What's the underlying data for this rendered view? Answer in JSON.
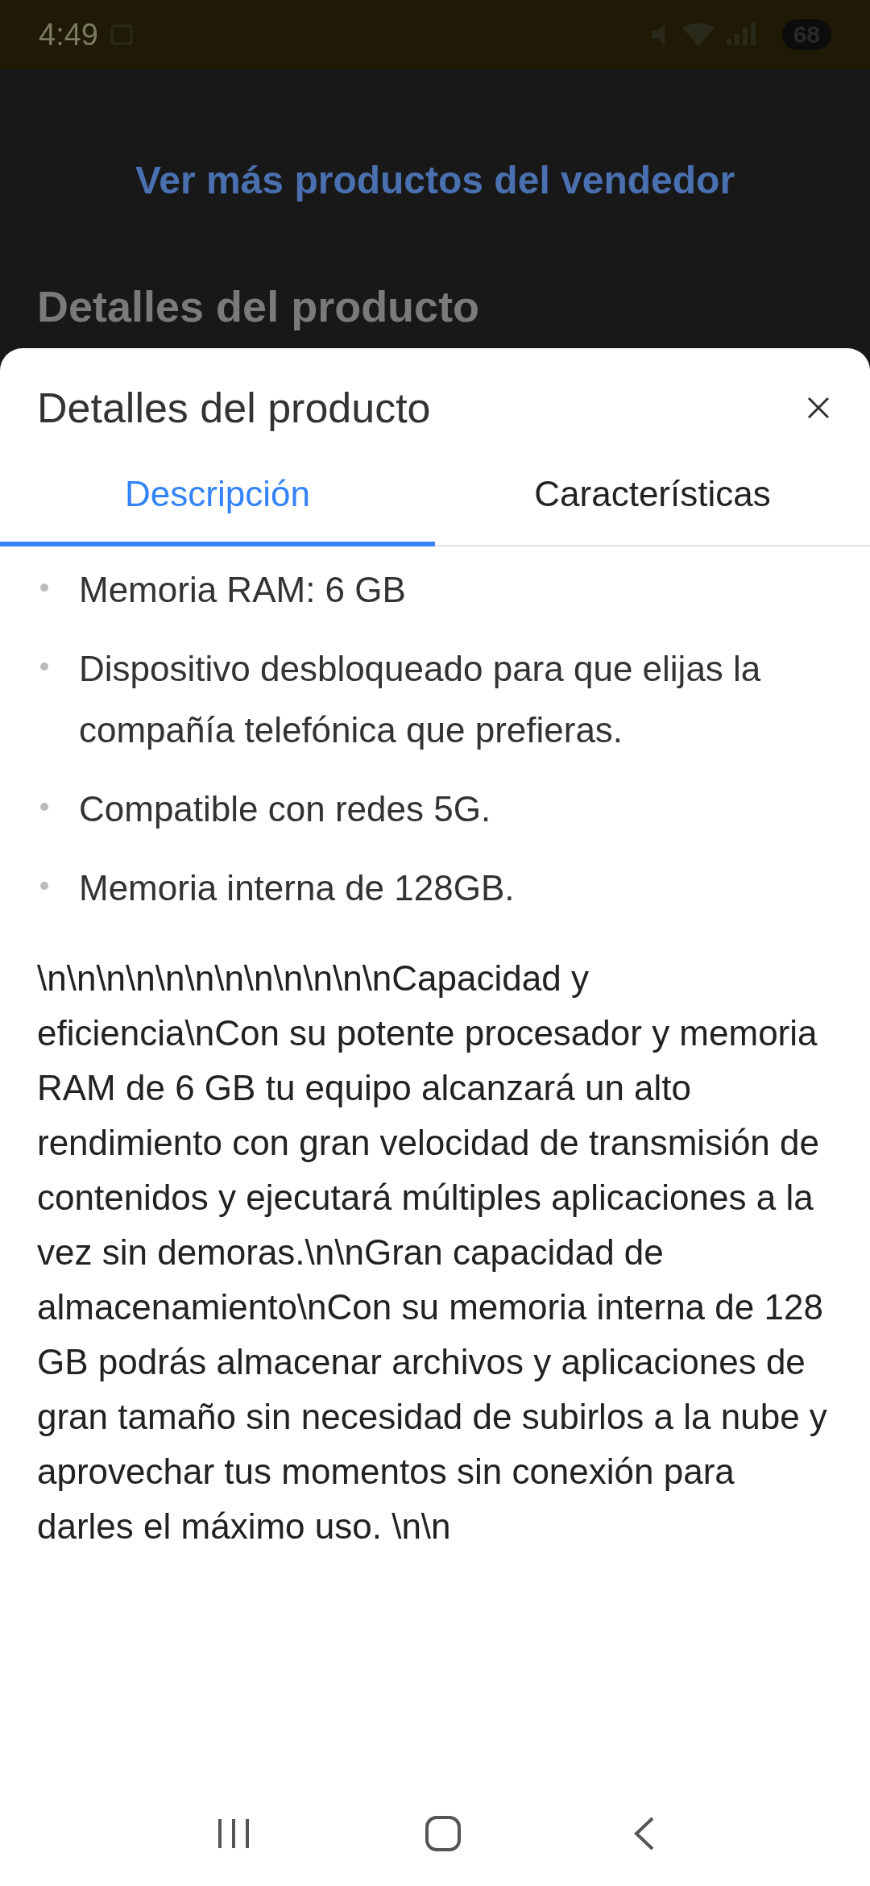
{
  "status_bar": {
    "time": "4:49",
    "battery": "68"
  },
  "background": {
    "link": "Ver más productos del vendedor",
    "heading": "Detalles del producto"
  },
  "sheet": {
    "title": "Detalles del producto",
    "tabs": [
      {
        "label": "Descripción",
        "selected": true
      },
      {
        "label": "Características",
        "selected": false
      }
    ],
    "bullets": [
      "Memoria RAM: 6 GB",
      "Dispositivo desbloqueado para que elijas la compañía telefónica que prefieras.",
      "Compatible con redes 5G.",
      "Memoria interna de 128GB."
    ],
    "paragraph": "\\n\\n\\n\\n\\n\\n\\n\\n\\n\\n\\n\\nCapacidad y eficiencia\\nCon su potente procesador y memoria RAM de 6 GB tu equipo alcanzará un alto rendimiento con gran velocidad de transmisión de contenidos y ejecutará múltiples aplicaciones a la vez sin demoras.\\n\\nGran capacidad de almacenamiento\\nCon su memoria interna de 128 GB podrás almacenar archivos y aplicaciones de gran tamaño sin necesidad de subirlos a la nube y aprovechar tus momentos sin conexión para darles el máximo uso. \\n\\n"
  }
}
